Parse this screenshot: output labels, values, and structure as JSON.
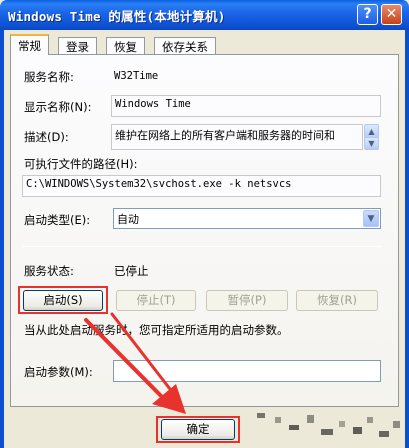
{
  "window": {
    "title": "Windows Time 的属性(本地计算机)",
    "help_glyph": "?",
    "close_glyph": "✕"
  },
  "tabs": [
    {
      "label": "常规",
      "active": true
    },
    {
      "label": "登录",
      "active": false
    },
    {
      "label": "恢复",
      "active": false
    },
    {
      "label": "依存关系",
      "active": false
    }
  ],
  "general": {
    "service_name_label": "服务名称:",
    "service_name_value": "W32Time",
    "display_name_label": "显示名称(N):",
    "display_name_value": "Windows Time",
    "description_label": "描述(D):",
    "description_value": "维护在网络上的所有客户端和服务器的时间和",
    "exe_path_label": "可执行文件的路径(H):",
    "exe_path_value": "C:\\WINDOWS\\System32\\svchost.exe -k netsvcs",
    "startup_type_label": "启动类型(E):",
    "startup_type_value": "自动",
    "status_label": "服务状态:",
    "status_value": "已停止",
    "buttons": {
      "start": "启动(S)",
      "stop": "停止(T)",
      "pause": "暂停(P)",
      "resume": "恢复(R)"
    },
    "hint": "当从此处启动服务时，您可指定所适用的启动参数。",
    "start_params_label": "启动参数(M):",
    "start_params_value": ""
  },
  "footer": {
    "ok": "确定"
  },
  "colors": {
    "highlight_box": "#e8322d",
    "titlebar": "#0f54d6"
  }
}
